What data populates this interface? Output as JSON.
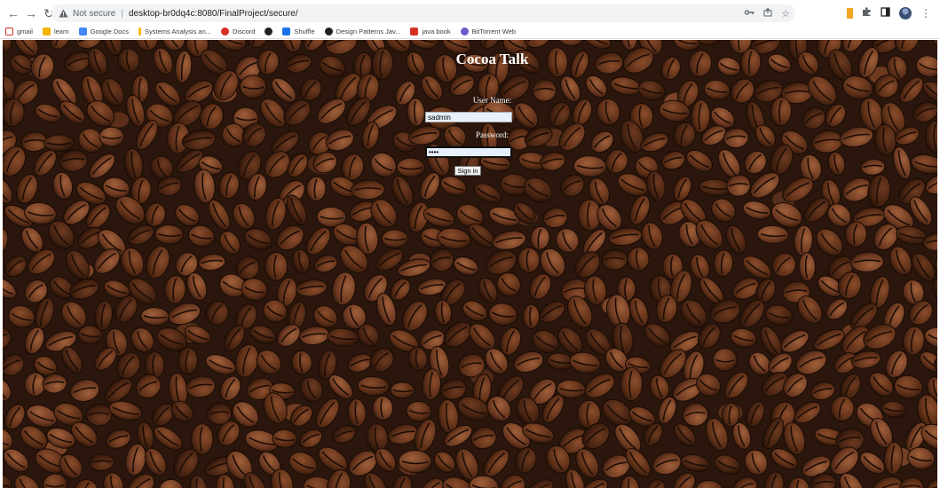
{
  "browser": {
    "url_security": "Not secure",
    "url": "desktop-br0dq4c:8080/FinalProject/secure/",
    "bookmarks": [
      {
        "label": "gmail",
        "icon": "gmail-icon",
        "color": "#d93025"
      },
      {
        "label": "learn",
        "icon": "learn-icon",
        "color": "#f4b400"
      },
      {
        "label": "Google Docs",
        "icon": "google-docs-icon",
        "color": "#4285f4"
      },
      {
        "label": "Systems Analysis an...",
        "icon": "systems-analysis-icon",
        "color": "#fbbc04"
      },
      {
        "label": "Discord",
        "icon": "discord-icon",
        "color": "#d93025"
      },
      {
        "label": "",
        "icon": "github-icon",
        "color": "#202124"
      },
      {
        "label": "Shuffle",
        "icon": "shuffle-icon",
        "color": "#1a73e8"
      },
      {
        "label": "Design Patterns Jav...",
        "icon": "design-patterns-icon",
        "color": "#202124"
      },
      {
        "label": "java book",
        "icon": "java-book-icon",
        "color": "#d93025"
      },
      {
        "label": "BitTorrent Web",
        "icon": "bittorrent-icon",
        "color": "#6a5acd"
      }
    ]
  },
  "page": {
    "title": "Cocoa Talk",
    "username_label": "User Name:",
    "username_value": "sadmin",
    "password_label": "Password:",
    "password_value": "••••",
    "signin_label": "Sign in"
  }
}
